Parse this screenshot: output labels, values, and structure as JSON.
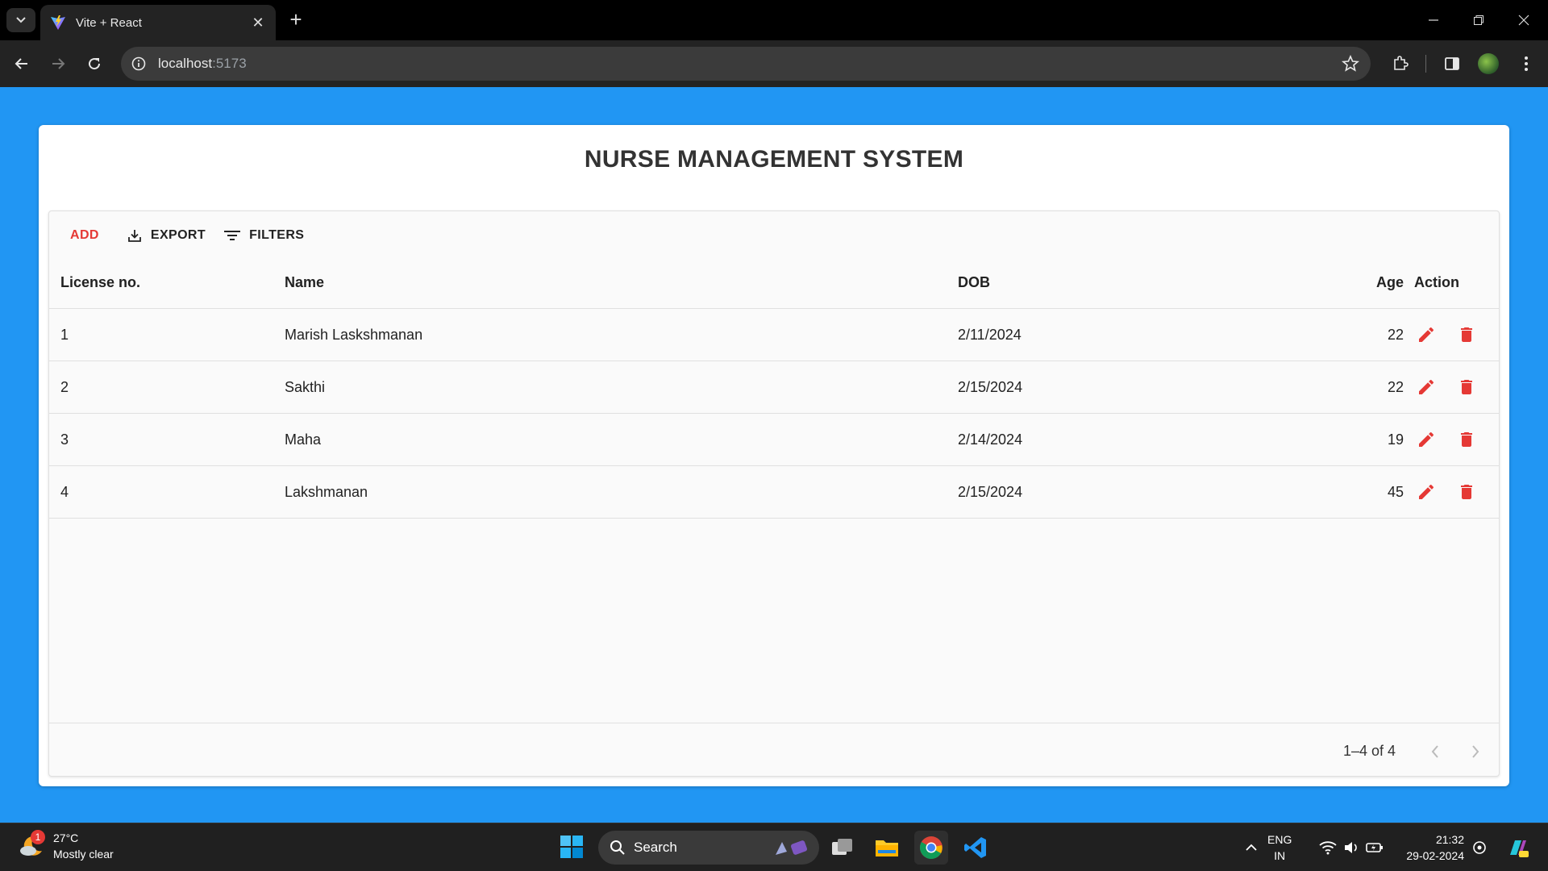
{
  "browser": {
    "tab_title": "Vite + React",
    "url_host": "localhost",
    "url_port": ":5173"
  },
  "page": {
    "title": "NURSE MANAGEMENT SYSTEM"
  },
  "grid_toolbar": {
    "add_label": "ADD",
    "export_label": "EXPORT",
    "filters_label": "FILTERS"
  },
  "table": {
    "headers": {
      "license": "License no.",
      "name": "Name",
      "dob": "DOB",
      "age": "Age",
      "action": "Action"
    },
    "rows": [
      {
        "license": "1",
        "name": "Marish Laskshmanan",
        "dob": "2/11/2024",
        "age": "22"
      },
      {
        "license": "2",
        "name": "Sakthi",
        "dob": "2/15/2024",
        "age": "22"
      },
      {
        "license": "3",
        "name": "Maha",
        "dob": "2/14/2024",
        "age": "19"
      },
      {
        "license": "4",
        "name": "Lakshmanan",
        "dob": "2/15/2024",
        "age": "45"
      }
    ],
    "action_color": "#e53935"
  },
  "pagination": {
    "text": "1–4 of 4"
  },
  "taskbar": {
    "weather_badge": "1",
    "temperature": "27°C",
    "condition": "Mostly clear",
    "search_label": "Search",
    "lang_line1": "ENG",
    "lang_line2": "IN",
    "time": "21:32",
    "date": "29-02-2024"
  },
  "colors": {
    "page_background": "#2196f3",
    "accent": "#e53935"
  }
}
